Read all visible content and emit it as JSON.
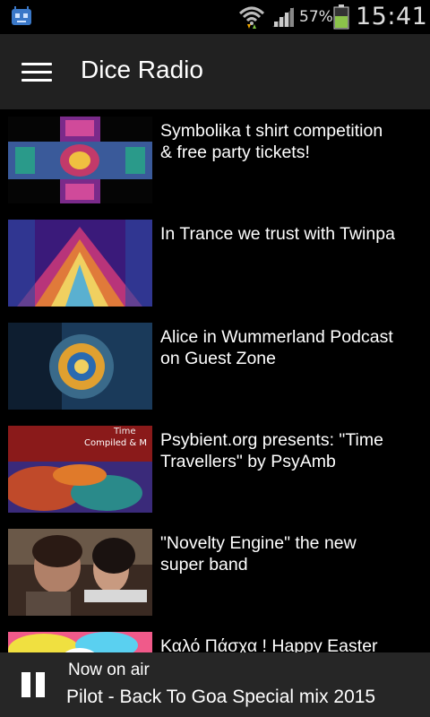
{
  "status_bar": {
    "app_icon": "android-robot-icon",
    "wifi_icon": "wifi-icon",
    "signal_icon": "signal-bars-icon",
    "battery_percent": "57%",
    "battery_level": 0.57,
    "battery_icon": "battery-icon",
    "time": "15:41"
  },
  "app_bar": {
    "menu_icon": "hamburger-menu-icon",
    "title": "Dice Radio"
  },
  "items": [
    {
      "title": "Symbolika t shirt competition\n& free party tickets!"
    },
    {
      "title": "In Trance we trust with Twinpa"
    },
    {
      "title": "Alice in Wummerland Podcast\non Guest Zone"
    },
    {
      "title": "Psybient.org presents: \"Time\nTravellers\" by PsyAmb"
    },
    {
      "title": "\"Novelty Engine\" the new\nsuper band"
    },
    {
      "title": "Καλό Πάσχα ! Happy Easter"
    }
  ],
  "thumbs": {
    "t4_text": "Compiled & M",
    "t4_top": "Time"
  },
  "player": {
    "pause_icon": "pause-icon",
    "label": "Now on air",
    "track": "Pilot - Back To Goa Special mix 2015"
  },
  "colors": {
    "app_bar": "#212121",
    "player_bar": "#262626",
    "battery_green": "#8bc34a"
  }
}
